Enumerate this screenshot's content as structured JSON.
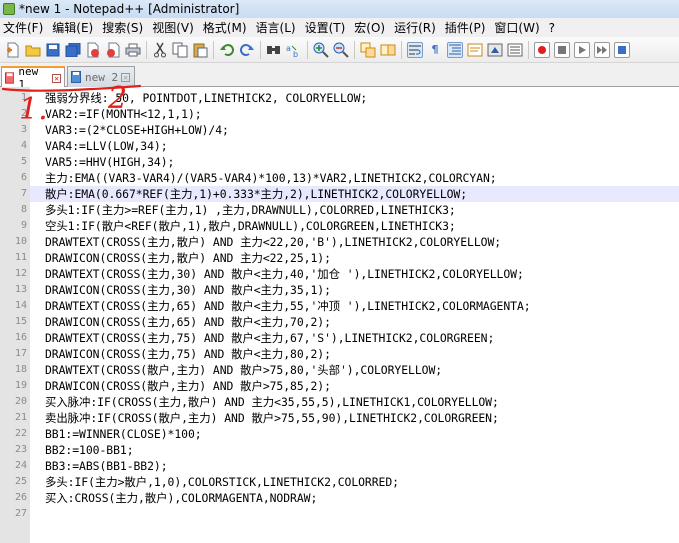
{
  "window": {
    "title": "*new 1 - Notepad++ [Administrator]"
  },
  "menu": [
    "文件(F)",
    "编辑(E)",
    "搜索(S)",
    "视图(V)",
    "格式(M)",
    "语言(L)",
    "设置(T)",
    "宏(O)",
    "运行(R)",
    "插件(P)",
    "窗口(W)",
    "?"
  ],
  "toolbar": {
    "icons": [
      "new-file-icon",
      "open-file-icon",
      "save-icon",
      "save-all-icon",
      "close-icon",
      "close-all-icon",
      "print-icon",
      "cut-icon",
      "copy-icon",
      "paste-icon",
      "undo-icon",
      "redo-icon",
      "find-icon",
      "replace-icon",
      "zoom-in-icon",
      "zoom-out-icon",
      "sync-vertical-icon",
      "sync-horizontal-icon",
      "word-wrap-icon",
      "show-all-chars-icon",
      "indent-guide-icon",
      "user-language-icon",
      "doc-map-icon",
      "function-list-icon",
      "record-macro-icon",
      "stop-record-icon",
      "play-macro-icon",
      "run-macro-multiple-icon",
      "save-macro-icon"
    ]
  },
  "tabs": [
    {
      "label": "new 1",
      "active": true
    },
    {
      "label": "new 2",
      "active": false
    }
  ],
  "editor": {
    "current_line": 7,
    "lines": [
      {
        "n": "1",
        "text": "强弱分界线: 50, POINTDOT,LINETHICK2, COLORYELLOW;"
      },
      {
        "n": "2",
        "text": "VAR2:=IF(MONTH<12,1,1);"
      },
      {
        "n": "3",
        "text": "VAR3:=(2*CLOSE+HIGH+LOW)/4;"
      },
      {
        "n": "4",
        "text": "VAR4:=LLV(LOW,34);"
      },
      {
        "n": "5",
        "text": "VAR5:=HHV(HIGH,34);"
      },
      {
        "n": "6",
        "text": "主力:EMA((VAR3-VAR4)/(VAR5-VAR4)*100,13)*VAR2,LINETHICK2,COLORCYAN;"
      },
      {
        "n": "7",
        "text": "散户:EMA(0.667*REF(主力,1)+0.333*主力,2),LINETHICK2,COLORYELLOW;"
      },
      {
        "n": "8",
        "text": "多头1:IF(主力>=REF(主力,1) ,主力,DRAWNULL),COLORRED,LINETHICK3;"
      },
      {
        "n": "9",
        "text": "空头1:IF(散户<REF(散户,1),散户,DRAWNULL),COLORGREEN,LINETHICK3;"
      },
      {
        "n": "10",
        "text": "DRAWTEXT(CROSS(主力,散户) AND 主力<22,20,'B'),LINETHICK2,COLORYELLOW;"
      },
      {
        "n": "11",
        "text": "DRAWICON(CROSS(主力,散户) AND 主力<22,25,1);"
      },
      {
        "n": "12",
        "text": "DRAWTEXT(CROSS(主力,30) AND 散户<主力,40,'加仓 '),LINETHICK2,COLORYELLOW;"
      },
      {
        "n": "13",
        "text": "DRAWICON(CROSS(主力,30) AND 散户<主力,35,1);"
      },
      {
        "n": "14",
        "text": "DRAWTEXT(CROSS(主力,65) AND 散户<主力,55,'冲顶 '),LINETHICK2,COLORMAGENTA;"
      },
      {
        "n": "15",
        "text": "DRAWICON(CROSS(主力,65) AND 散户<主力,70,2);"
      },
      {
        "n": "16",
        "text": "DRAWTEXT(CROSS(主力,75) AND 散户<主力,67,'S'),LINETHICK2,COLORGREEN;"
      },
      {
        "n": "17",
        "text": "DRAWICON(CROSS(主力,75) AND 散户<主力,80,2);"
      },
      {
        "n": "18",
        "text": "DRAWTEXT(CROSS(散户,主力) AND 散户>75,80,'头部'),COLORYELLOW;"
      },
      {
        "n": "19",
        "text": "DRAWICON(CROSS(散户,主力) AND 散户>75,85,2);"
      },
      {
        "n": "20",
        "text": "买入脉冲:IF(CROSS(主力,散户) AND 主力<35,55,5),LINETHICK1,COLORYELLOW;"
      },
      {
        "n": "21",
        "text": "卖出脉冲:IF(CROSS(散户,主力) AND 散户>75,55,90),LINETHICK2,COLORGREEN;"
      },
      {
        "n": "22",
        "text": "BB1:=WINNER(CLOSE)*100;"
      },
      {
        "n": "23",
        "text": "BB2:=100-BB1;"
      },
      {
        "n": "24",
        "text": "BB3:=ABS(BB1-BB2);"
      },
      {
        "n": "25",
        "text": "多头:IF(主力>散户,1,0),COLORSTICK,LINETHICK2,COLORRED;"
      },
      {
        "n": "26",
        "text": "买入:CROSS(主力,散户),COLORMAGENTA,NODRAW;"
      },
      {
        "n": "27",
        "text": ""
      }
    ]
  },
  "annotations": {
    "color": "#e0201a",
    "mark_1": "1.",
    "mark_2": "2"
  }
}
